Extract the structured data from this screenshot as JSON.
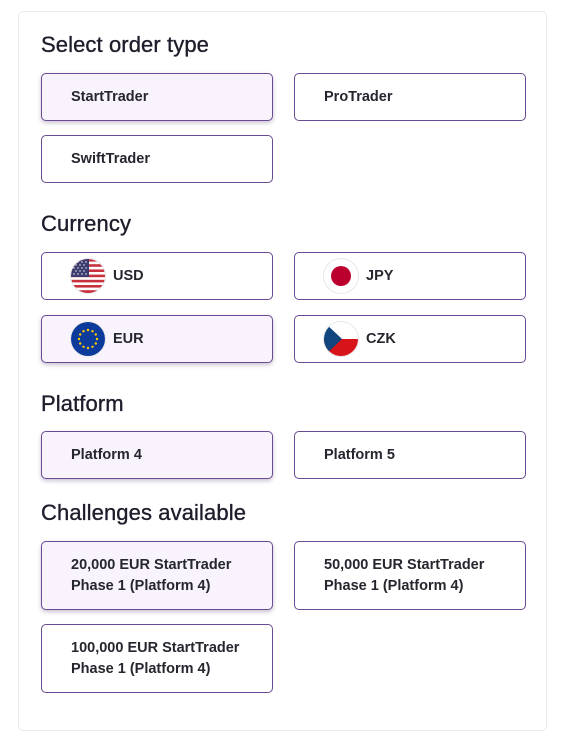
{
  "sections": {
    "order_type": {
      "title": "Select order type",
      "options": [
        {
          "label": "StartTrader",
          "selected": true
        },
        {
          "label": "ProTrader",
          "selected": false
        },
        {
          "label": "SwiftTrader",
          "selected": false
        }
      ]
    },
    "currency": {
      "title": "Currency",
      "options": [
        {
          "label": "USD",
          "icon": "us-flag-icon",
          "selected": false
        },
        {
          "label": "JPY",
          "icon": "japan-flag-icon",
          "selected": false
        },
        {
          "label": "EUR",
          "icon": "eu-flag-icon",
          "selected": true
        },
        {
          "label": "CZK",
          "icon": "czech-flag-icon",
          "selected": false
        }
      ]
    },
    "platform": {
      "title": "Platform",
      "options": [
        {
          "label": "Platform 4",
          "selected": true
        },
        {
          "label": "Platform 5",
          "selected": false
        }
      ]
    },
    "challenges": {
      "title": "Challenges available",
      "options": [
        {
          "label": "20,000 EUR StartTrader\nPhase 1 (Platform 4)",
          "selected": true
        },
        {
          "label": "50,000 EUR StartTrader\nPhase 1 (Platform 4)",
          "selected": false
        },
        {
          "label": "100,000 EUR StartTrader\nPhase 1 (Platform 4)",
          "selected": false
        }
      ]
    }
  },
  "colors": {
    "border_accent": "#6a4a93",
    "selected_bg": "#f8f3fd",
    "text": "#26262f"
  }
}
